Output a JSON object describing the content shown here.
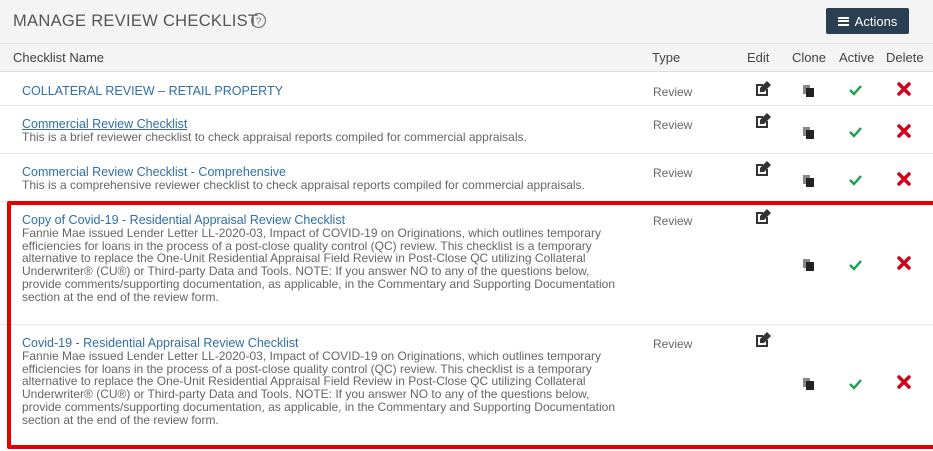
{
  "header": {
    "title": "MANAGE REVIEW CHECKLIST",
    "actions_label": "Actions"
  },
  "columns": [
    "Checklist Name",
    "Type",
    "Edit",
    "Clone",
    "Active",
    "Delete"
  ],
  "rows": [
    {
      "name": "COLLATERAL REVIEW – RETAIL PROPERTY",
      "description": "",
      "type": "Review"
    },
    {
      "name": "Commercial Review Checklist",
      "description": "This is a brief reviewer checklist to check appraisal reports compiled for commercial appraisals.",
      "type": "Review"
    },
    {
      "name": "Commercial Review Checklist - Comprehensive",
      "description": "This is a comprehensive reviewer checklist to check appraisal reports compiled for commercial appraisals.",
      "type": "Review"
    },
    {
      "name": "Copy of Covid-19 - Residential Appraisal Review Checklist",
      "description_lines": [
        "Fannie Mae issued Lender Letter LL-2020-03, Impact of COVID-19 on Originations, which outlines temporary",
        "efficiencies for loans in the process of a post-close quality control (QC) review. This checklist is a temporary",
        "alternative to replace the One-Unit Residential Appraisal Field Review in Post-Close QC utilizing Collateral",
        "Underwriter® (CU®) or Third-party Data and Tools. NOTE: If you answer NO to any of the questions below,",
        "provide comments/supporting documentation, as applicable, in the Commentary and Supporting Documentation",
        "section at the end of the review form."
      ],
      "type": "Review"
    },
    {
      "name": "Covid-19 - Residential Appraisal Review Checklist",
      "description_lines": [
        "Fannie Mae issued Lender Letter LL-2020-03, Impact of COVID-19 on Originations, which outlines temporary",
        "efficiencies for loans in the process of a post-close quality control (QC) review. This checklist is a temporary",
        "alternative to replace the One-Unit Residential Appraisal Field Review in Post-Close QC utilizing Collateral",
        "Underwriter® (CU®) or Third-party Data and Tools. NOTE: If you answer NO to any of the questions below,",
        "provide comments/supporting documentation, as applicable, in the Commentary and Supporting Documentation",
        "section at the end of the review form."
      ],
      "type": "Review"
    }
  ],
  "icons": {
    "edit": "edit-icon",
    "clone": "clone-icon",
    "active": "check-icon",
    "delete": "delete-icon",
    "help": "help-icon"
  },
  "colors": {
    "link": "#2f6ea7",
    "check": "#1aa04a",
    "delete": "#d0021b",
    "button": "#2b3f52",
    "highlight": "#e60000"
  }
}
